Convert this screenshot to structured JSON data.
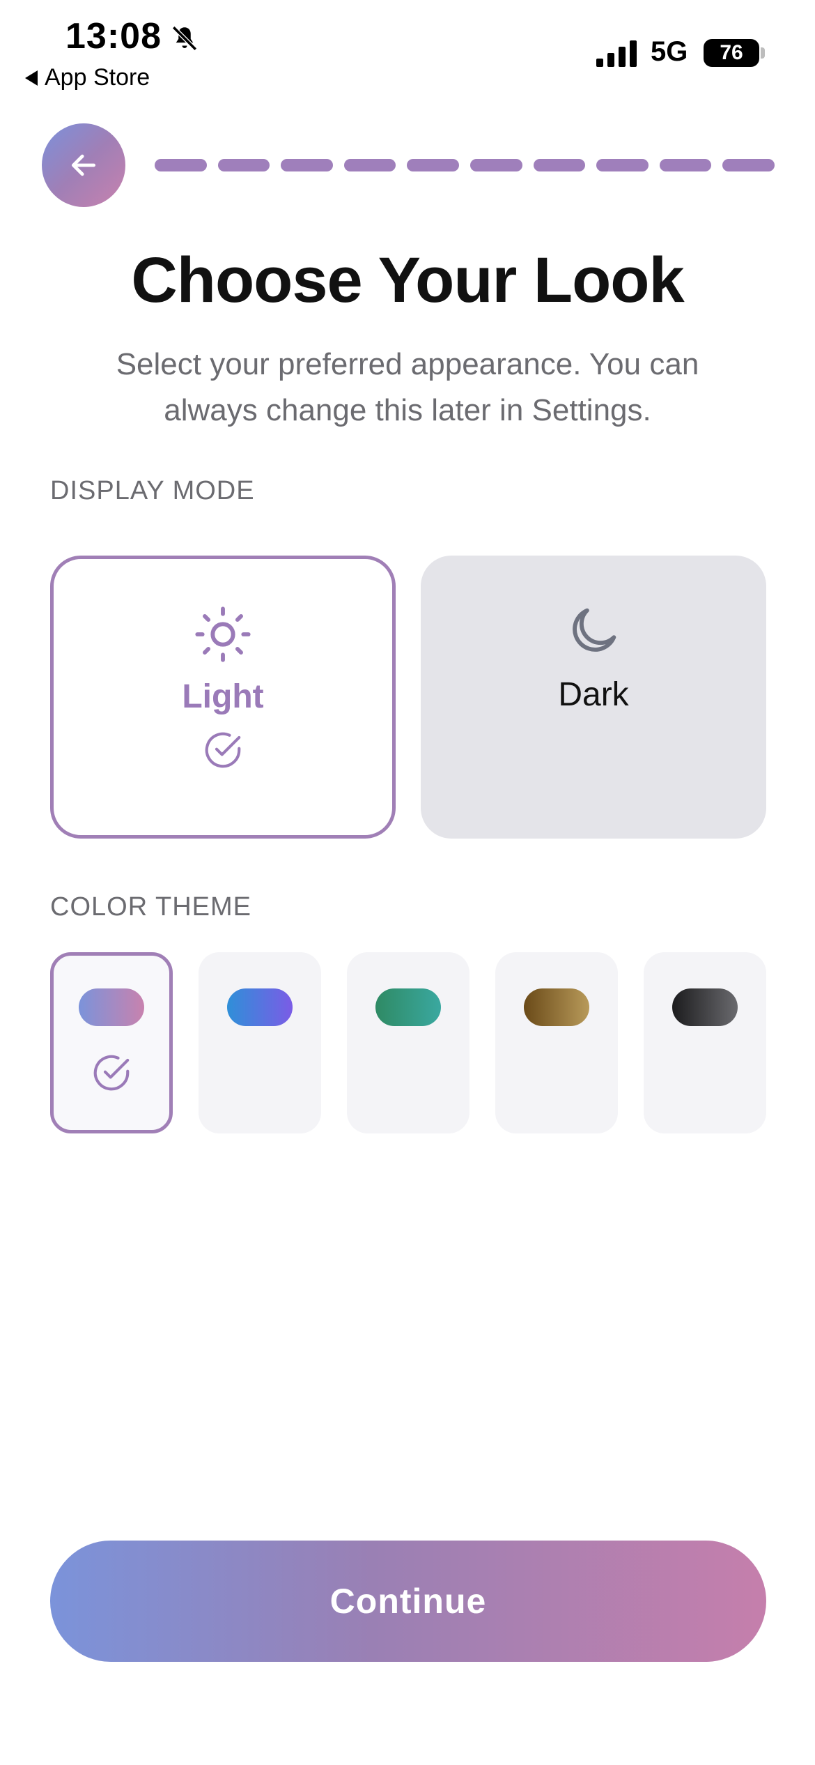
{
  "status_bar": {
    "time": "13:08",
    "back_app": "App Store",
    "network": "5G",
    "battery": "76"
  },
  "header": {
    "progress_steps_total": 10,
    "progress_steps_complete": 10
  },
  "title": "Choose Your Look",
  "subtitle": "Select your preferred appearance. You can always change this later in Settings.",
  "display_mode": {
    "label": "DISPLAY MODE",
    "options": [
      {
        "id": "light",
        "label": "Light",
        "icon": "sun-icon",
        "selected": true
      },
      {
        "id": "dark",
        "label": "Dark",
        "icon": "moon-icon",
        "selected": false
      }
    ]
  },
  "color_theme": {
    "label": "COLOR THEME",
    "options": [
      {
        "id": "theme-1",
        "colors": [
          "#7b93da",
          "#c882ae"
        ],
        "selected": true
      },
      {
        "id": "theme-2",
        "colors": [
          "#2f8fd8",
          "#7b5ce6"
        ],
        "selected": false
      },
      {
        "id": "theme-3",
        "colors": [
          "#2f8a64",
          "#3aa8a0"
        ],
        "selected": false
      },
      {
        "id": "theme-4",
        "colors": [
          "#6a4a18",
          "#b89a5a"
        ],
        "selected": false
      },
      {
        "id": "theme-5",
        "colors": [
          "#1c1c1e",
          "#6a6a6e"
        ],
        "selected": false
      }
    ]
  },
  "continue_label": "Continue",
  "colors": {
    "accent": "#a07fb6",
    "gradient_start": "#7b93da",
    "gradient_end": "#c882ae"
  }
}
